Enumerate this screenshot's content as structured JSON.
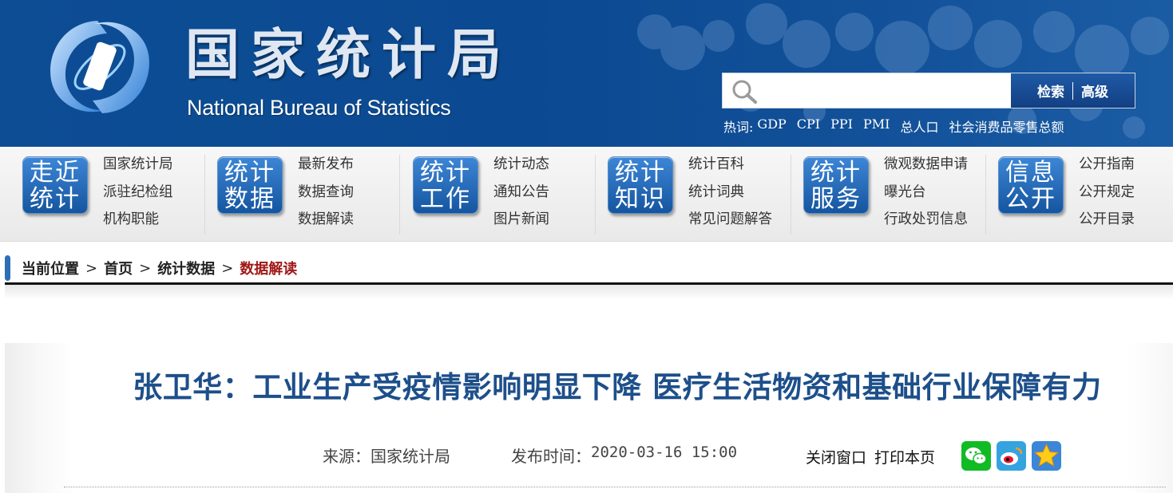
{
  "header": {
    "title_cn": "国家统计局",
    "title_en": "National Bureau of Statistics",
    "search": {
      "placeholder": "",
      "search_button": "检索",
      "advanced_button": "高级"
    },
    "hotwords_label": "热词:",
    "hotwords": [
      "GDP",
      "CPI",
      "PPI",
      "PMI",
      "总人口",
      "社会消费品零售总额"
    ]
  },
  "nav": [
    {
      "tile": [
        "走近",
        "统计"
      ],
      "links": [
        "国家统计局",
        "派驻纪检组",
        "机构职能"
      ]
    },
    {
      "tile": [
        "统计",
        "数据"
      ],
      "links": [
        "最新发布",
        "数据查询",
        "数据解读"
      ]
    },
    {
      "tile": [
        "统计",
        "工作"
      ],
      "links": [
        "统计动态",
        "通知公告",
        "图片新闻"
      ]
    },
    {
      "tile": [
        "统计",
        "知识"
      ],
      "links": [
        "统计百科",
        "统计词典",
        "常见问题解答"
      ]
    },
    {
      "tile": [
        "统计",
        "服务"
      ],
      "links": [
        "微观数据申请",
        "曝光台",
        "行政处罚信息"
      ]
    },
    {
      "tile": [
        "信息",
        "公开"
      ],
      "links": [
        "公开指南",
        "公开规定",
        "公开目录"
      ]
    }
  ],
  "breadcrumb": {
    "items": [
      "当前位置",
      "首页",
      "统计数据",
      "数据解读"
    ],
    "separator": ">"
  },
  "article": {
    "title": "张卫华：工业生产受疫情影响明显下降 医疗生活物资和基础行业保障有力",
    "source_label": "来源：",
    "source": "国家统计局",
    "time_label": "发布时间：",
    "time": "2020-03-16 15:00",
    "close_window": "关闭窗口",
    "print_page": "打印本页"
  },
  "icons": {
    "search": "search-icon",
    "share": [
      "wechat-icon",
      "weibo-icon",
      "favorite-star-icon"
    ]
  },
  "colors": {
    "header_blue": "#0d4d94",
    "title_blue": "#1d4f8a",
    "breadcrumb_current": "#a01818",
    "tile_blue": "#15559f"
  }
}
